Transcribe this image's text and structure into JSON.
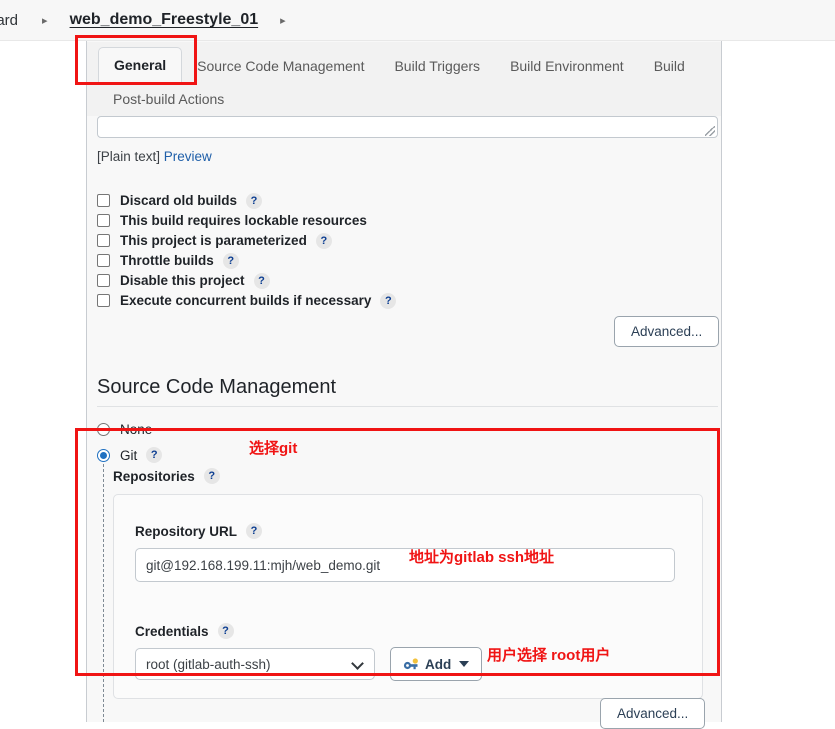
{
  "breadcrumb": {
    "items": [
      {
        "label": "oard",
        "type": "truncated-link"
      },
      {
        "label": "web_demo_Freestyle_01",
        "type": "current"
      }
    ],
    "separator": "▸"
  },
  "tabs": {
    "row1": [
      {
        "label": "General",
        "active": true
      },
      {
        "label": "Source Code Management",
        "active": false
      },
      {
        "label": "Build Triggers",
        "active": false
      },
      {
        "label": "Build Environment",
        "active": false
      },
      {
        "label": "Build",
        "active": false
      }
    ],
    "row2": [
      {
        "label": "Post-build Actions",
        "active": false
      }
    ]
  },
  "description": {
    "value": "",
    "plain_text_prefix": "[Plain text]",
    "preview_label": "Preview"
  },
  "checkboxes": [
    {
      "label": "Discard old builds",
      "checked": false,
      "help": true
    },
    {
      "label": "This build requires lockable resources",
      "checked": false,
      "help": false
    },
    {
      "label": "This project is parameterized",
      "checked": false,
      "help": true
    },
    {
      "label": "Throttle builds",
      "checked": false,
      "help": true
    },
    {
      "label": "Disable this project",
      "checked": false,
      "help": true
    },
    {
      "label": "Execute concurrent builds if necessary",
      "checked": false,
      "help": true
    }
  ],
  "buttons": {
    "advanced_general": "Advanced...",
    "advanced_scm": "Advanced...",
    "add": "Add"
  },
  "scm": {
    "heading": "Source Code Management",
    "options": [
      {
        "label": "None",
        "selected": false,
        "help": false
      },
      {
        "label": "Git",
        "selected": true,
        "help": true
      }
    ],
    "repositories_label": "Repositories",
    "repository": {
      "url_label": "Repository URL",
      "url_value": "git@192.168.199.11:mjh/web_demo.git",
      "credentials_label": "Credentials",
      "credentials_value": "root (gitlab-auth-ssh)"
    }
  },
  "help_glyph": "?",
  "annotations": [
    {
      "id": "select-git",
      "text": "选择git"
    },
    {
      "id": "gitlab-ssh-url",
      "text": "地址为gitlab ssh地址"
    },
    {
      "id": "select-root-user",
      "text": "用户选择 root用户"
    }
  ],
  "colors": {
    "annotation_red": "#f01414",
    "link_blue": "#1f5fa9",
    "radio_blue": "#1f70c1",
    "panel_bg": "#f8f8f8",
    "tabbar_bg": "#f2f2f2"
  }
}
